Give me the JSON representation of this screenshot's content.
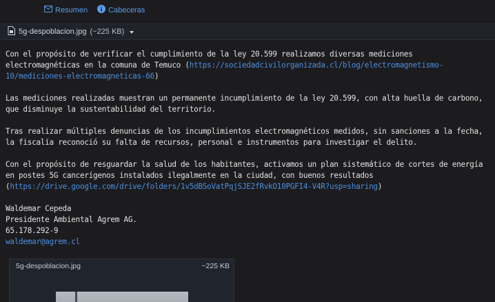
{
  "toolbar": {
    "summary_label": "Resumen",
    "headers_label": "Cabeceras"
  },
  "attachment": {
    "filename": "5g-despoblacion.jpg",
    "size": "(~225 KB)"
  },
  "message": {
    "p1_text": "Con el propósito de verificar el cumplimiento de la ley 20.599 realizamos diversas mediciones electromagnéticas en la comuna de Temuco (",
    "p1_link": "https://sociedadcivilorganizada.cl/blog/electromagnetismo-10/mediciones-electromagneticas-66",
    "p1_end": ")",
    "p2_text": "Las mediciones realizadas muestran un permanente incumplimiento de la ley 20.599, con alta huella de carbono, que disminuye la sustentabilidad del territorio.",
    "p3_text": "Tras realizar múltiples denuncias de los incumplimientos electromagnéticos medidos, sin sanciones a la fecha, la fiscalía reconoció su falta de recursos, personal e instrumentos para investigar el delito.",
    "p4_text": "Con el propósito de resguardar la salud de los habitantes, activamos un plan sistemático de cortes de energía en postes 5G cancerígenos instalados ilegalmente en la ciudad, con buenos resultados (",
    "p4_link": "https://drive.google.com/drive/folders/1v5dBSoVatPqjSJE2fRvkO10PGFI4-V4R?usp=sharing",
    "p4_end": ")"
  },
  "signature": {
    "name": "Waldemar Cepeda",
    "title": "Presidente Ambiental Agrem AG.",
    "rut": "65.178.292-9",
    "email": "waldemar@agrem.cl"
  },
  "preview": {
    "filename": "5g-despoblacion.jpg",
    "size": "~225 KB"
  },
  "colors": {
    "background": "#1c1b1e",
    "link": "#4a90e2",
    "toolbar_link": "#5b9ee8"
  }
}
